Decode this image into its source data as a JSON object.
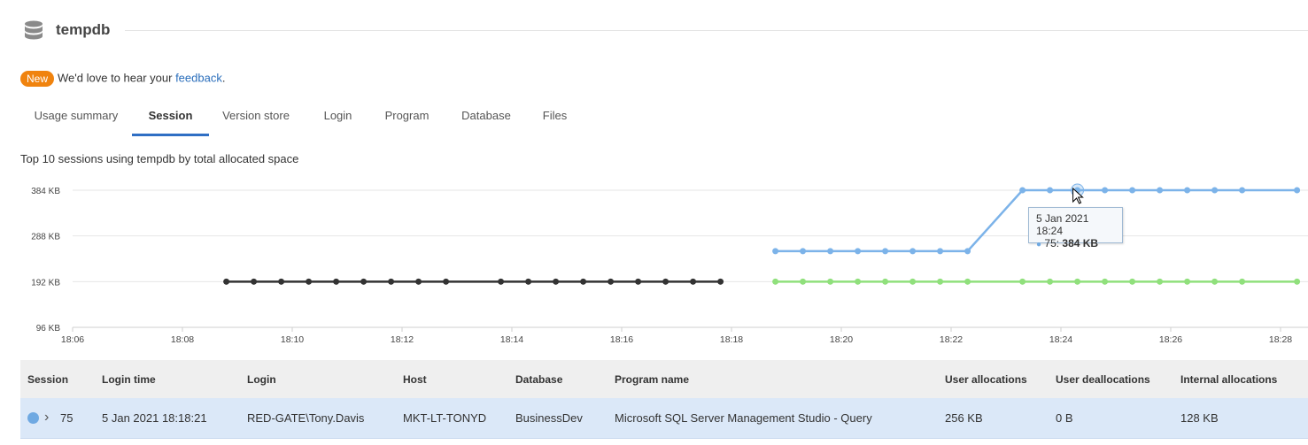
{
  "header": {
    "title": "tempdb",
    "icon": "database-icon"
  },
  "feedback": {
    "badge": "New",
    "text_before": "We'd love to hear your ",
    "link": "feedback",
    "text_after": "."
  },
  "tabs": [
    {
      "label": "Usage summary",
      "active": false
    },
    {
      "label": "Session",
      "active": true
    },
    {
      "label": "Version store",
      "active": false
    },
    {
      "label": "Login",
      "active": false
    },
    {
      "label": "Program",
      "active": false
    },
    {
      "label": "Database",
      "active": false
    },
    {
      "label": "Files",
      "active": false
    }
  ],
  "chart_caption": "Top 10 sessions using tempdb by total allocated space",
  "chart_data": {
    "type": "line",
    "y_ticks": [
      "384 KB",
      "288 KB",
      "192 KB",
      "96 KB"
    ],
    "y_tick_values": [
      384,
      288,
      192,
      96
    ],
    "ylim": [
      96,
      384
    ],
    "x_ticks": [
      "18:06",
      "18:08",
      "18:10",
      "18:12",
      "18:14",
      "18:16",
      "18:18",
      "18:20",
      "18:22",
      "18:24",
      "18:26",
      "18:28"
    ],
    "xlim": [
      "18:06",
      "18:28.5"
    ],
    "grid": true,
    "series": [
      {
        "color": "#333333",
        "x": [
          "18:08.8",
          "18:09.3",
          "18:09.8",
          "18:10.3",
          "18:10.8",
          "18:11.3",
          "18:11.8",
          "18:12.3",
          "18:12.8",
          "18:13.8",
          "18:14.3",
          "18:14.8",
          "18:15.3",
          "18:15.8",
          "18:16.3",
          "18:16.8",
          "18:17.3",
          "18:17.8"
        ],
        "values": [
          192,
          192,
          192,
          192,
          192,
          192,
          192,
          192,
          192,
          192,
          192,
          192,
          192,
          192,
          192,
          192,
          192,
          192
        ]
      },
      {
        "name": "75",
        "color": "#7cb3e9",
        "x": [
          "18:18.8",
          "18:19.3",
          "18:19.8",
          "18:20.3",
          "18:20.8",
          "18:21.3",
          "18:21.8",
          "18:22.3",
          "18:23.3",
          "18:23.8",
          "18:24.3",
          "18:24.8",
          "18:25.3",
          "18:25.8",
          "18:26.3",
          "18:26.8",
          "18:27.3",
          "18:28.3"
        ],
        "values": [
          256,
          256,
          256,
          256,
          256,
          256,
          256,
          256,
          384,
          384,
          384,
          384,
          384,
          384,
          384,
          384,
          384,
          384
        ]
      },
      {
        "color": "#90e07c",
        "x": [
          "18:18.8",
          "18:19.3",
          "18:19.8",
          "18:20.3",
          "18:20.8",
          "18:21.3",
          "18:21.8",
          "18:22.3",
          "18:23.3",
          "18:23.8",
          "18:24.3",
          "18:24.8",
          "18:25.3",
          "18:25.8",
          "18:26.3",
          "18:26.8",
          "18:27.3",
          "18:28.3"
        ],
        "values": [
          192,
          192,
          192,
          192,
          192,
          192,
          192,
          192,
          192,
          192,
          192,
          192,
          192,
          192,
          192,
          192,
          192,
          192
        ]
      }
    ],
    "tooltip": {
      "title": "5 Jan 2021 18:24",
      "series": "75: ",
      "value": "384 KB"
    }
  },
  "table": {
    "columns": [
      "Session",
      "Login time",
      "Login",
      "Host",
      "Database",
      "Program name",
      "User allocations",
      "User deallocations",
      "Internal allocations"
    ],
    "rows": [
      {
        "session": "75",
        "login_time": "5 Jan 2021 18:18:21",
        "login": "RED-GATE\\Tony.Davis",
        "host": "MKT-LT-TONYD",
        "database": "BusinessDev",
        "program": "Microsoft SQL Server Management Studio - Query",
        "user_alloc": "256 KB",
        "user_dealloc": "0 B",
        "internal_alloc": "128 KB",
        "dot_color": "#6fa9e2"
      }
    ]
  }
}
